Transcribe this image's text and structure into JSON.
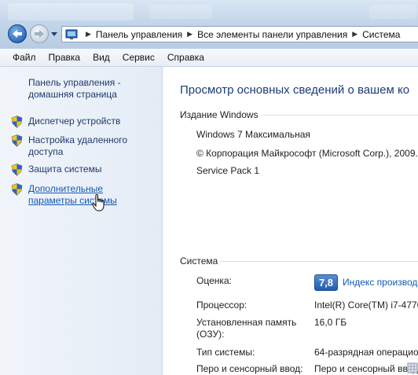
{
  "window": {
    "breadcrumb": [
      "Панель управления",
      "Все элементы панели управления",
      "Система"
    ]
  },
  "menu": [
    "Файл",
    "Правка",
    "Вид",
    "Сервис",
    "Справка"
  ],
  "sidebar": {
    "home_label": "Панель управления - домашняя страница",
    "items": [
      {
        "label": "Диспетчер устройств",
        "icon": "shield-icon"
      },
      {
        "label": "Настройка удаленного доступа",
        "icon": "shield-icon"
      },
      {
        "label": "Защита системы",
        "icon": "shield-icon"
      },
      {
        "label": "Дополнительные параметры системы",
        "icon": "shield-icon",
        "state": "hover"
      }
    ]
  },
  "main": {
    "title": "Просмотр основных сведений о вашем ко",
    "edition_section": {
      "label": "Издание Windows",
      "edition": "Windows 7 Максимальная",
      "copyright": "© Корпорация Майкрософт (Microsoft Corp.), 2009.",
      "service_pack": "Service Pack 1"
    },
    "system_section": {
      "label": "Система",
      "rating_label": "Оценка:",
      "rating_value": "7,8",
      "rating_link": "Индекс производ",
      "processor_label": "Процессор:",
      "processor_value": "Intel(R) Core(TM) i7-4770",
      "memory_label": "Установленная память (ОЗУ):",
      "memory_value": "16,0 ГБ",
      "type_label": "Тип системы:",
      "type_value": "64-разрядная операцио",
      "pen_label": "Перо и сенсорный ввод:",
      "pen_value": "Перо и сенсорный ввод"
    }
  },
  "colors": {
    "link": "#1558b5",
    "title": "#1e3a78",
    "sidebar_bg": "#e3ecf6"
  }
}
